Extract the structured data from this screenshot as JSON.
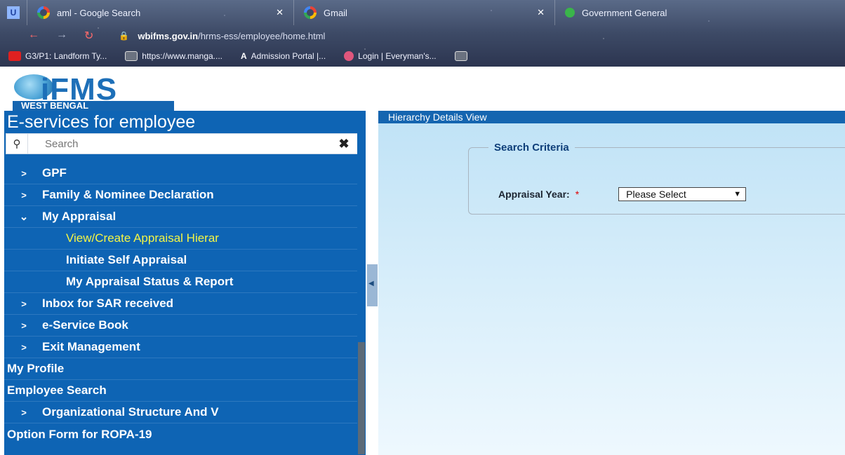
{
  "browser": {
    "tabs": [
      {
        "icon": "google-icon",
        "label": "aml - Google Search"
      },
      {
        "icon": "google-icon",
        "label": "Gmail"
      },
      {
        "icon": "gov-icon",
        "label": "Government General"
      }
    ],
    "url_host": "wbifms.gov.in",
    "url_path": "/hrms-ess/employee/home.html",
    "bookmarks": [
      {
        "label": "G3/P1: Landform Ty...",
        "color": "#e02020"
      },
      {
        "label": "https://www.manga....",
        "color": "#6b7280"
      },
      {
        "label": "Admission Portal |...",
        "color": "#222222"
      },
      {
        "label": "Login | Everyman's...",
        "color": "#e0567c"
      }
    ]
  },
  "logo": {
    "brand": "iFMS",
    "sub": "WEST BENGAL"
  },
  "sidebar": {
    "title": "E-services for employee",
    "search_placeholder": "Search",
    "items": [
      {
        "arrow": ">",
        "label": "GPF",
        "level": "item"
      },
      {
        "arrow": ">",
        "label": "Family & Nominee Declaration",
        "level": "item"
      },
      {
        "arrow": "⌄",
        "label": "My Appraisal",
        "level": "item"
      },
      {
        "arrow": "",
        "label": "View/Create Appraisal Hierar",
        "level": "sub",
        "active": true
      },
      {
        "arrow": "",
        "label": "Initiate Self Appraisal",
        "level": "sub"
      },
      {
        "arrow": "",
        "label": "My Appraisal Status & Report",
        "level": "sub"
      },
      {
        "arrow": ">",
        "label": "Inbox for SAR received",
        "level": "item"
      },
      {
        "arrow": ">",
        "label": "e-Service Book",
        "level": "item"
      },
      {
        "arrow": ">",
        "label": "Exit Management",
        "level": "item"
      },
      {
        "arrow": "",
        "label": "My Profile",
        "level": "top"
      },
      {
        "arrow": "",
        "label": "Employee Search",
        "level": "top"
      },
      {
        "arrow": ">",
        "label": "Organizational Structure And V",
        "level": "item"
      },
      {
        "arrow": "",
        "label": "Option Form for ROPA-19",
        "level": "top"
      }
    ]
  },
  "main": {
    "header": "Hierarchy Details View",
    "fieldset_legend": "Search Criteria",
    "appraisal_year_label": "Appraisal Year:",
    "required_mark": "*",
    "appraisal_year_value": "Please Select"
  }
}
